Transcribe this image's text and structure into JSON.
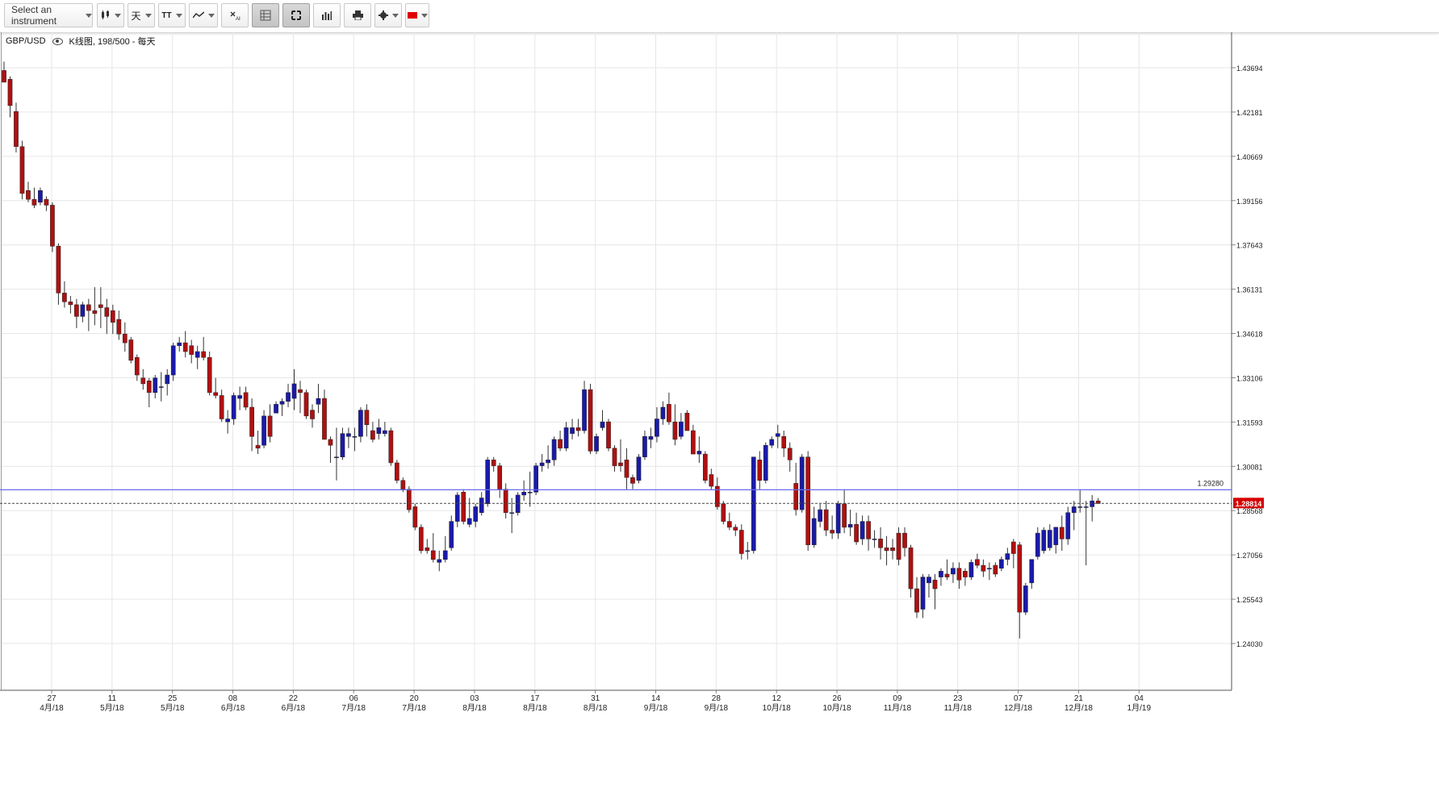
{
  "toolbar": {
    "instrument_placeholder": "Select an instrument",
    "chart_type_icon": "candlestick-icon",
    "period_label": "天",
    "text_tool_label": "TT",
    "indicators_icon": "indicator-icon",
    "clear_icon": "clear-drawings-icon",
    "grid_icon": "grid-icon",
    "fullscreen_icon": "fullscreen-icon",
    "volume_icon": "volume-bars-icon",
    "print_icon": "print-icon",
    "settings_icon": "settings-icon",
    "language_flag": "china-flag-icon"
  },
  "chart_info": {
    "symbol": "GBP/USD",
    "description": "K线图, 198/500 - 每天"
  },
  "colors": {
    "up": "#1a1aaa",
    "down": "#b01010",
    "hline": "#6a6af0",
    "price_tag": "#d60000",
    "grid": "#e6e6e6"
  },
  "chart_data": {
    "type": "candlestick",
    "symbol": "GBP/USD",
    "y_ticks": [
      "1.43694",
      "1.42181",
      "1.40669",
      "1.39156",
      "1.37643",
      "1.36131",
      "1.34618",
      "1.33106",
      "1.31593",
      "1.30081",
      "1.28568",
      "1.27056",
      "1.25543",
      "1.24030"
    ],
    "ylim": [
      1.2245,
      1.4521
    ],
    "x_ticks": [
      {
        "day": "27",
        "month": "4月/18"
      },
      {
        "day": "11",
        "month": "5月/18"
      },
      {
        "day": "25",
        "month": "5月/18"
      },
      {
        "day": "08",
        "month": "6月/18"
      },
      {
        "day": "22",
        "month": "6月/18"
      },
      {
        "day": "06",
        "month": "7月/18"
      },
      {
        "day": "20",
        "month": "7月/18"
      },
      {
        "day": "03",
        "month": "8月/18"
      },
      {
        "day": "17",
        "month": "8月/18"
      },
      {
        "day": "31",
        "month": "8月/18"
      },
      {
        "day": "14",
        "month": "9月/18"
      },
      {
        "day": "28",
        "month": "9月/18"
      },
      {
        "day": "12",
        "month": "10月/18"
      },
      {
        "day": "26",
        "month": "10月/18"
      },
      {
        "day": "09",
        "month": "11月/18"
      },
      {
        "day": "23",
        "month": "11月/18"
      },
      {
        "day": "07",
        "month": "12月/18"
      },
      {
        "day": "21",
        "month": "12月/18"
      },
      {
        "day": "04",
        "month": "1月/19"
      }
    ],
    "horizontal_line": {
      "value": 1.2928,
      "label": "1.29280"
    },
    "current_price": {
      "value": 1.28814,
      "label": "1.28814"
    },
    "ohlc": [
      [
        1.436,
        1.439,
        1.432,
        1.432
      ],
      [
        1.433,
        1.434,
        1.42,
        1.424
      ],
      [
        1.422,
        1.425,
        1.408,
        1.41
      ],
      [
        1.41,
        1.412,
        1.392,
        1.394
      ],
      [
        1.395,
        1.398,
        1.391,
        1.392
      ],
      [
        1.392,
        1.396,
        1.389,
        1.39
      ],
      [
        1.391,
        1.396,
        1.39,
        1.395
      ],
      [
        1.392,
        1.393,
        1.388,
        1.39
      ],
      [
        1.39,
        1.391,
        1.374,
        1.376
      ],
      [
        1.376,
        1.377,
        1.356,
        1.36
      ],
      [
        1.36,
        1.364,
        1.355,
        1.357
      ],
      [
        1.357,
        1.359,
        1.353,
        1.356
      ],
      [
        1.356,
        1.358,
        1.348,
        1.352
      ],
      [
        1.352,
        1.357,
        1.35,
        1.356
      ],
      [
        1.356,
        1.358,
        1.347,
        1.354
      ],
      [
        1.354,
        1.362,
        1.349,
        1.353
      ],
      [
        1.356,
        1.362,
        1.348,
        1.355
      ],
      [
        1.355,
        1.358,
        1.346,
        1.352
      ],
      [
        1.354,
        1.356,
        1.346,
        1.35
      ],
      [
        1.351,
        1.354,
        1.344,
        1.346
      ],
      [
        1.346,
        1.35,
        1.34,
        1.343
      ],
      [
        1.344,
        1.345,
        1.336,
        1.337
      ],
      [
        1.338,
        1.339,
        1.33,
        1.332
      ],
      [
        1.331,
        1.334,
        1.327,
        1.329
      ],
      [
        1.33,
        1.331,
        1.321,
        1.326
      ],
      [
        1.326,
        1.332,
        1.324,
        1.331
      ],
      [
        1.328,
        1.333,
        1.323,
        1.328
      ],
      [
        1.329,
        1.334,
        1.325,
        1.332
      ],
      [
        1.332,
        1.343,
        1.33,
        1.342
      ],
      [
        1.342,
        1.345,
        1.34,
        1.343
      ],
      [
        1.343,
        1.347,
        1.338,
        1.34
      ],
      [
        1.342,
        1.344,
        1.336,
        1.339
      ],
      [
        1.338,
        1.342,
        1.334,
        1.34
      ],
      [
        1.34,
        1.345,
        1.337,
        1.338
      ],
      [
        1.338,
        1.34,
        1.325,
        1.326
      ],
      [
        1.326,
        1.331,
        1.324,
        1.325
      ],
      [
        1.325,
        1.327,
        1.316,
        1.317
      ],
      [
        1.316,
        1.32,
        1.312,
        1.317
      ],
      [
        1.317,
        1.326,
        1.315,
        1.325
      ],
      [
        1.324,
        1.328,
        1.32,
        1.325
      ],
      [
        1.326,
        1.328,
        1.32,
        1.321
      ],
      [
        1.321,
        1.324,
        1.306,
        1.311
      ],
      [
        1.308,
        1.313,
        1.305,
        1.307
      ],
      [
        1.308,
        1.32,
        1.307,
        1.318
      ],
      [
        1.318,
        1.322,
        1.309,
        1.311
      ],
      [
        1.319,
        1.323,
        1.319,
        1.322
      ],
      [
        1.322,
        1.324,
        1.318,
        1.323
      ],
      [
        1.323,
        1.329,
        1.321,
        1.326
      ],
      [
        1.324,
        1.334,
        1.32,
        1.329
      ],
      [
        1.327,
        1.33,
        1.319,
        1.326
      ],
      [
        1.326,
        1.327,
        1.317,
        1.318
      ],
      [
        1.32,
        1.322,
        1.314,
        1.317
      ],
      [
        1.322,
        1.329,
        1.319,
        1.324
      ],
      [
        1.324,
        1.327,
        1.31,
        1.31
      ],
      [
        1.31,
        1.311,
        1.302,
        1.308
      ],
      [
        1.304,
        1.314,
        1.296,
        1.304
      ],
      [
        1.304,
        1.314,
        1.303,
        1.312
      ],
      [
        1.311,
        1.314,
        1.307,
        1.312
      ],
      [
        1.311,
        1.314,
        1.306,
        1.311
      ],
      [
        1.311,
        1.321,
        1.309,
        1.32
      ],
      [
        1.32,
        1.322,
        1.311,
        1.315
      ],
      [
        1.313,
        1.316,
        1.309,
        1.31
      ],
      [
        1.312,
        1.317,
        1.31,
        1.314
      ],
      [
        1.312,
        1.316,
        1.311,
        1.313
      ],
      [
        1.313,
        1.314,
        1.301,
        1.302
      ],
      [
        1.302,
        1.303,
        1.295,
        1.296
      ],
      [
        1.296,
        1.297,
        1.292,
        1.293
      ],
      [
        1.293,
        1.294,
        1.285,
        1.286
      ],
      [
        1.287,
        1.288,
        1.279,
        1.28
      ],
      [
        1.28,
        1.281,
        1.271,
        1.272
      ],
      [
        1.273,
        1.276,
        1.271,
        1.272
      ],
      [
        1.272,
        1.278,
        1.268,
        1.269
      ],
      [
        1.268,
        1.272,
        1.265,
        1.269
      ],
      [
        1.269,
        1.277,
        1.268,
        1.272
      ],
      [
        1.273,
        1.284,
        1.272,
        1.282
      ],
      [
        1.282,
        1.292,
        1.28,
        1.291
      ],
      [
        1.292,
        1.293,
        1.281,
        1.282
      ],
      [
        1.281,
        1.29,
        1.28,
        1.283
      ],
      [
        1.282,
        1.288,
        1.28,
        1.287
      ],
      [
        1.285,
        1.292,
        1.284,
        1.29
      ],
      [
        1.288,
        1.304,
        1.287,
        1.303
      ],
      [
        1.303,
        1.304,
        1.299,
        1.301
      ],
      [
        1.301,
        1.302,
        1.29,
        1.293
      ],
      [
        1.293,
        1.295,
        1.283,
        1.285
      ],
      [
        1.285,
        1.29,
        1.278,
        1.285
      ],
      [
        1.285,
        1.292,
        1.284,
        1.291
      ],
      [
        1.291,
        1.296,
        1.289,
        1.292
      ],
      [
        1.292,
        1.299,
        1.287,
        1.292
      ],
      [
        1.292,
        1.302,
        1.291,
        1.301
      ],
      [
        1.301,
        1.305,
        1.299,
        1.302
      ],
      [
        1.302,
        1.308,
        1.3,
        1.303
      ],
      [
        1.303,
        1.311,
        1.301,
        1.31
      ],
      [
        1.31,
        1.313,
        1.306,
        1.307
      ],
      [
        1.307,
        1.316,
        1.306,
        1.314
      ],
      [
        1.312,
        1.317,
        1.31,
        1.314
      ],
      [
        1.314,
        1.317,
        1.311,
        1.313
      ],
      [
        1.313,
        1.33,
        1.312,
        1.327
      ],
      [
        1.327,
        1.329,
        1.305,
        1.306
      ],
      [
        1.306,
        1.312,
        1.305,
        1.311
      ],
      [
        1.314,
        1.32,
        1.313,
        1.316
      ],
      [
        1.316,
        1.317,
        1.306,
        1.307
      ],
      [
        1.307,
        1.308,
        1.299,
        1.301
      ],
      [
        1.302,
        1.31,
        1.299,
        1.301
      ],
      [
        1.303,
        1.307,
        1.293,
        1.297
      ],
      [
        1.297,
        1.298,
        1.293,
        1.295
      ],
      [
        1.296,
        1.305,
        1.295,
        1.304
      ],
      [
        1.304,
        1.313,
        1.303,
        1.311
      ],
      [
        1.31,
        1.314,
        1.307,
        1.311
      ],
      [
        1.311,
        1.321,
        1.309,
        1.317
      ],
      [
        1.317,
        1.323,
        1.315,
        1.321
      ],
      [
        1.322,
        1.326,
        1.315,
        1.316
      ],
      [
        1.316,
        1.322,
        1.308,
        1.31
      ],
      [
        1.311,
        1.319,
        1.31,
        1.316
      ],
      [
        1.319,
        1.32,
        1.313,
        1.313
      ],
      [
        1.313,
        1.315,
        1.305,
        1.305
      ],
      [
        1.305,
        1.311,
        1.302,
        1.306
      ],
      [
        1.305,
        1.306,
        1.295,
        1.296
      ],
      [
        1.298,
        1.3,
        1.293,
        1.294
      ],
      [
        1.294,
        1.297,
        1.286,
        1.287
      ],
      [
        1.288,
        1.289,
        1.281,
        1.282
      ],
      [
        1.282,
        1.285,
        1.279,
        1.28
      ],
      [
        1.28,
        1.281,
        1.277,
        1.279
      ],
      [
        1.279,
        1.281,
        1.269,
        1.271
      ],
      [
        1.272,
        1.275,
        1.269,
        1.272
      ],
      [
        1.272,
        1.304,
        1.271,
        1.304
      ],
      [
        1.303,
        1.306,
        1.293,
        1.296
      ],
      [
        1.296,
        1.309,
        1.295,
        1.308
      ],
      [
        1.308,
        1.311,
        1.307,
        1.31
      ],
      [
        1.311,
        1.315,
        1.307,
        1.312
      ],
      [
        1.311,
        1.313,
        1.304,
        1.307
      ],
      [
        1.307,
        1.309,
        1.299,
        1.303
      ],
      [
        1.295,
        1.302,
        1.284,
        1.286
      ],
      [
        1.286,
        1.305,
        1.285,
        1.304
      ],
      [
        1.304,
        1.306,
        1.272,
        1.274
      ],
      [
        1.274,
        1.287,
        1.273,
        1.283
      ],
      [
        1.282,
        1.288,
        1.28,
        1.286
      ],
      [
        1.286,
        1.289,
        1.277,
        1.279
      ],
      [
        1.279,
        1.284,
        1.276,
        1.278
      ],
      [
        1.278,
        1.289,
        1.276,
        1.288
      ],
      [
        1.288,
        1.293,
        1.278,
        1.28
      ],
      [
        1.28,
        1.286,
        1.277,
        1.281
      ],
      [
        1.281,
        1.285,
        1.274,
        1.275
      ],
      [
        1.276,
        1.284,
        1.274,
        1.282
      ],
      [
        1.282,
        1.284,
        1.272,
        1.276
      ],
      [
        1.276,
        1.279,
        1.273,
        1.276
      ],
      [
        1.276,
        1.28,
        1.269,
        1.273
      ],
      [
        1.273,
        1.277,
        1.267,
        1.272
      ],
      [
        1.273,
        1.276,
        1.269,
        1.272
      ],
      [
        1.278,
        1.28,
        1.267,
        1.269
      ],
      [
        1.278,
        1.28,
        1.27,
        1.273
      ],
      [
        1.273,
        1.274,
        1.256,
        1.259
      ],
      [
        1.259,
        1.263,
        1.249,
        1.251
      ],
      [
        1.252,
        1.264,
        1.249,
        1.263
      ],
      [
        1.261,
        1.264,
        1.256,
        1.263
      ],
      [
        1.262,
        1.264,
        1.252,
        1.259
      ],
      [
        1.263,
        1.266,
        1.26,
        1.265
      ],
      [
        1.264,
        1.269,
        1.262,
        1.263
      ],
      [
        1.264,
        1.268,
        1.261,
        1.266
      ],
      [
        1.266,
        1.268,
        1.259,
        1.262
      ],
      [
        1.265,
        1.266,
        1.26,
        1.263
      ],
      [
        1.263,
        1.269,
        1.262,
        1.268
      ],
      [
        1.269,
        1.271,
        1.266,
        1.267
      ],
      [
        1.267,
        1.269,
        1.263,
        1.265
      ],
      [
        1.266,
        1.268,
        1.262,
        1.266
      ],
      [
        1.267,
        1.268,
        1.263,
        1.264
      ],
      [
        1.266,
        1.27,
        1.265,
        1.269
      ],
      [
        1.269,
        1.273,
        1.267,
        1.271
      ],
      [
        1.275,
        1.276,
        1.266,
        1.271
      ],
      [
        1.274,
        1.275,
        1.242,
        1.251
      ],
      [
        1.251,
        1.261,
        1.25,
        1.26
      ],
      [
        1.261,
        1.269,
        1.259,
        1.269
      ],
      [
        1.27,
        1.28,
        1.269,
        1.278
      ],
      [
        1.272,
        1.28,
        1.271,
        1.279
      ],
      [
        1.273,
        1.281,
        1.272,
        1.279
      ],
      [
        1.274,
        1.28,
        1.271,
        1.28
      ],
      [
        1.28,
        1.284,
        1.272,
        1.276
      ],
      [
        1.276,
        1.287,
        1.274,
        1.285
      ],
      [
        1.285,
        1.289,
        1.279,
        1.287
      ],
      [
        1.287,
        1.293,
        1.285,
        1.287
      ],
      [
        1.287,
        1.289,
        1.267,
        1.287
      ],
      [
        1.287,
        1.291,
        1.282,
        1.289
      ],
      [
        1.289,
        1.29,
        1.288,
        1.2881
      ]
    ]
  }
}
